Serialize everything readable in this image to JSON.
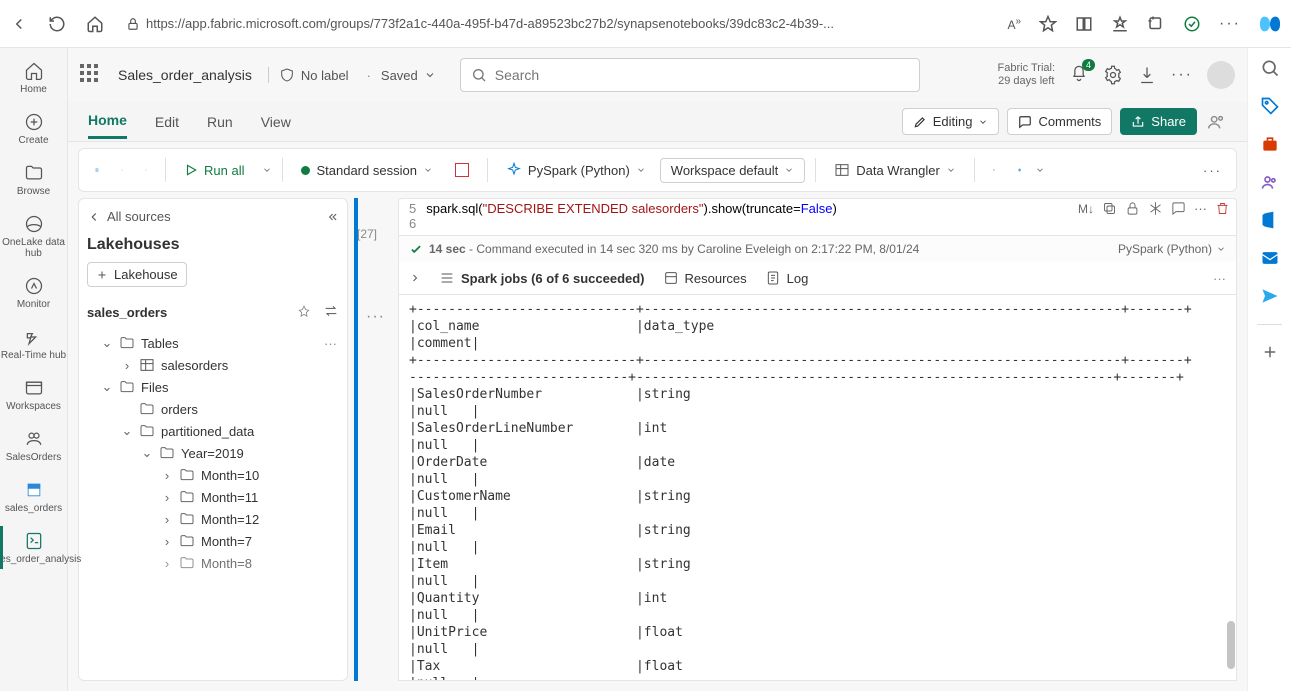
{
  "browser": {
    "url": "https://app.fabric.microsoft.com/groups/773f2a1c-440a-495f-b47d-a89523bc27b2/synapsenotebooks/39dc83c2-4b39-..."
  },
  "leftRail": {
    "items": [
      {
        "label": "Home"
      },
      {
        "label": "Create"
      },
      {
        "label": "Browse"
      },
      {
        "label": "OneLake data hub"
      },
      {
        "label": "Monitor"
      },
      {
        "label": "Real-Time hub"
      },
      {
        "label": "Workspaces"
      },
      {
        "label": "SalesOrders"
      },
      {
        "label": "sales_orders"
      },
      {
        "label": "Sales_order_analysis"
      }
    ]
  },
  "header": {
    "title": "Sales_order_analysis",
    "label": "No label",
    "saved": "Saved",
    "searchPlaceholder": "Search",
    "trial1": "Fabric Trial:",
    "trial2": "29 days left",
    "notifCount": "4"
  },
  "tabs": {
    "items": [
      "Home",
      "Edit",
      "Run",
      "View"
    ],
    "editing": "Editing",
    "comments": "Comments",
    "share": "Share"
  },
  "toolbar": {
    "runAll": "Run all",
    "session": "Standard session",
    "lang": "PySpark (Python)",
    "workspace": "Workspace default",
    "wrangler": "Data Wrangler"
  },
  "explorer": {
    "allSources": "All sources",
    "title": "Lakehouses",
    "addBtn": "Lakehouse",
    "sourceName": "sales_orders",
    "tables": "Tables",
    "tableItem": "salesorders",
    "files": "Files",
    "folders": {
      "orders": "orders",
      "partitioned": "partitioned_data",
      "year": "Year=2019",
      "months": [
        "Month=10",
        "Month=11",
        "Month=12",
        "Month=7",
        "Month=8"
      ]
    }
  },
  "cell": {
    "lineA": "5",
    "lineB": "6",
    "codePrefix": "spark.sql(",
    "codeStr": "\"DESCRIBE EXTENDED salesorders\"",
    "codeMid": ").show(truncate=",
    "codeBool": "False",
    "codeEnd": ")",
    "execLabel": "[27]",
    "statusTime": "14 sec",
    "statusMsg": " - Command executed in 14 sec 320 ms by Caroline Eveleigh on 2:17:22 PM, 8/01/24",
    "langBadge": "PySpark (Python)",
    "sparkJobs": "Spark jobs (6 of 6 succeeded)",
    "resources": "Resources",
    "log": "Log",
    "mdIcon": "M↓"
  },
  "output": "+----------------------------+-------------------------------------------------------------+-------+\n|col_name                    |data_type                                                              \n|comment|\n+----------------------------+-------------------------------------------------------------+-------+\n----------------------------+-------------------------------------------------------------+-------+\n|SalesOrderNumber            |string                                                                 \n|null   |\n|SalesOrderLineNumber        |int                                                                    \n|null   |\n|OrderDate                   |date                                                                   \n|null   |\n|CustomerName                |string                                                                 \n|null   |\n|Email                       |string                                                                 \n|null   |\n|Item                        |string                                                                 \n|null   |\n|Quantity                    |int                                                                    \n|null   |\n|UnitPrice                   |float                                                                  \n|null   |\n|Tax                         |float                                                                  \n|null   |"
}
